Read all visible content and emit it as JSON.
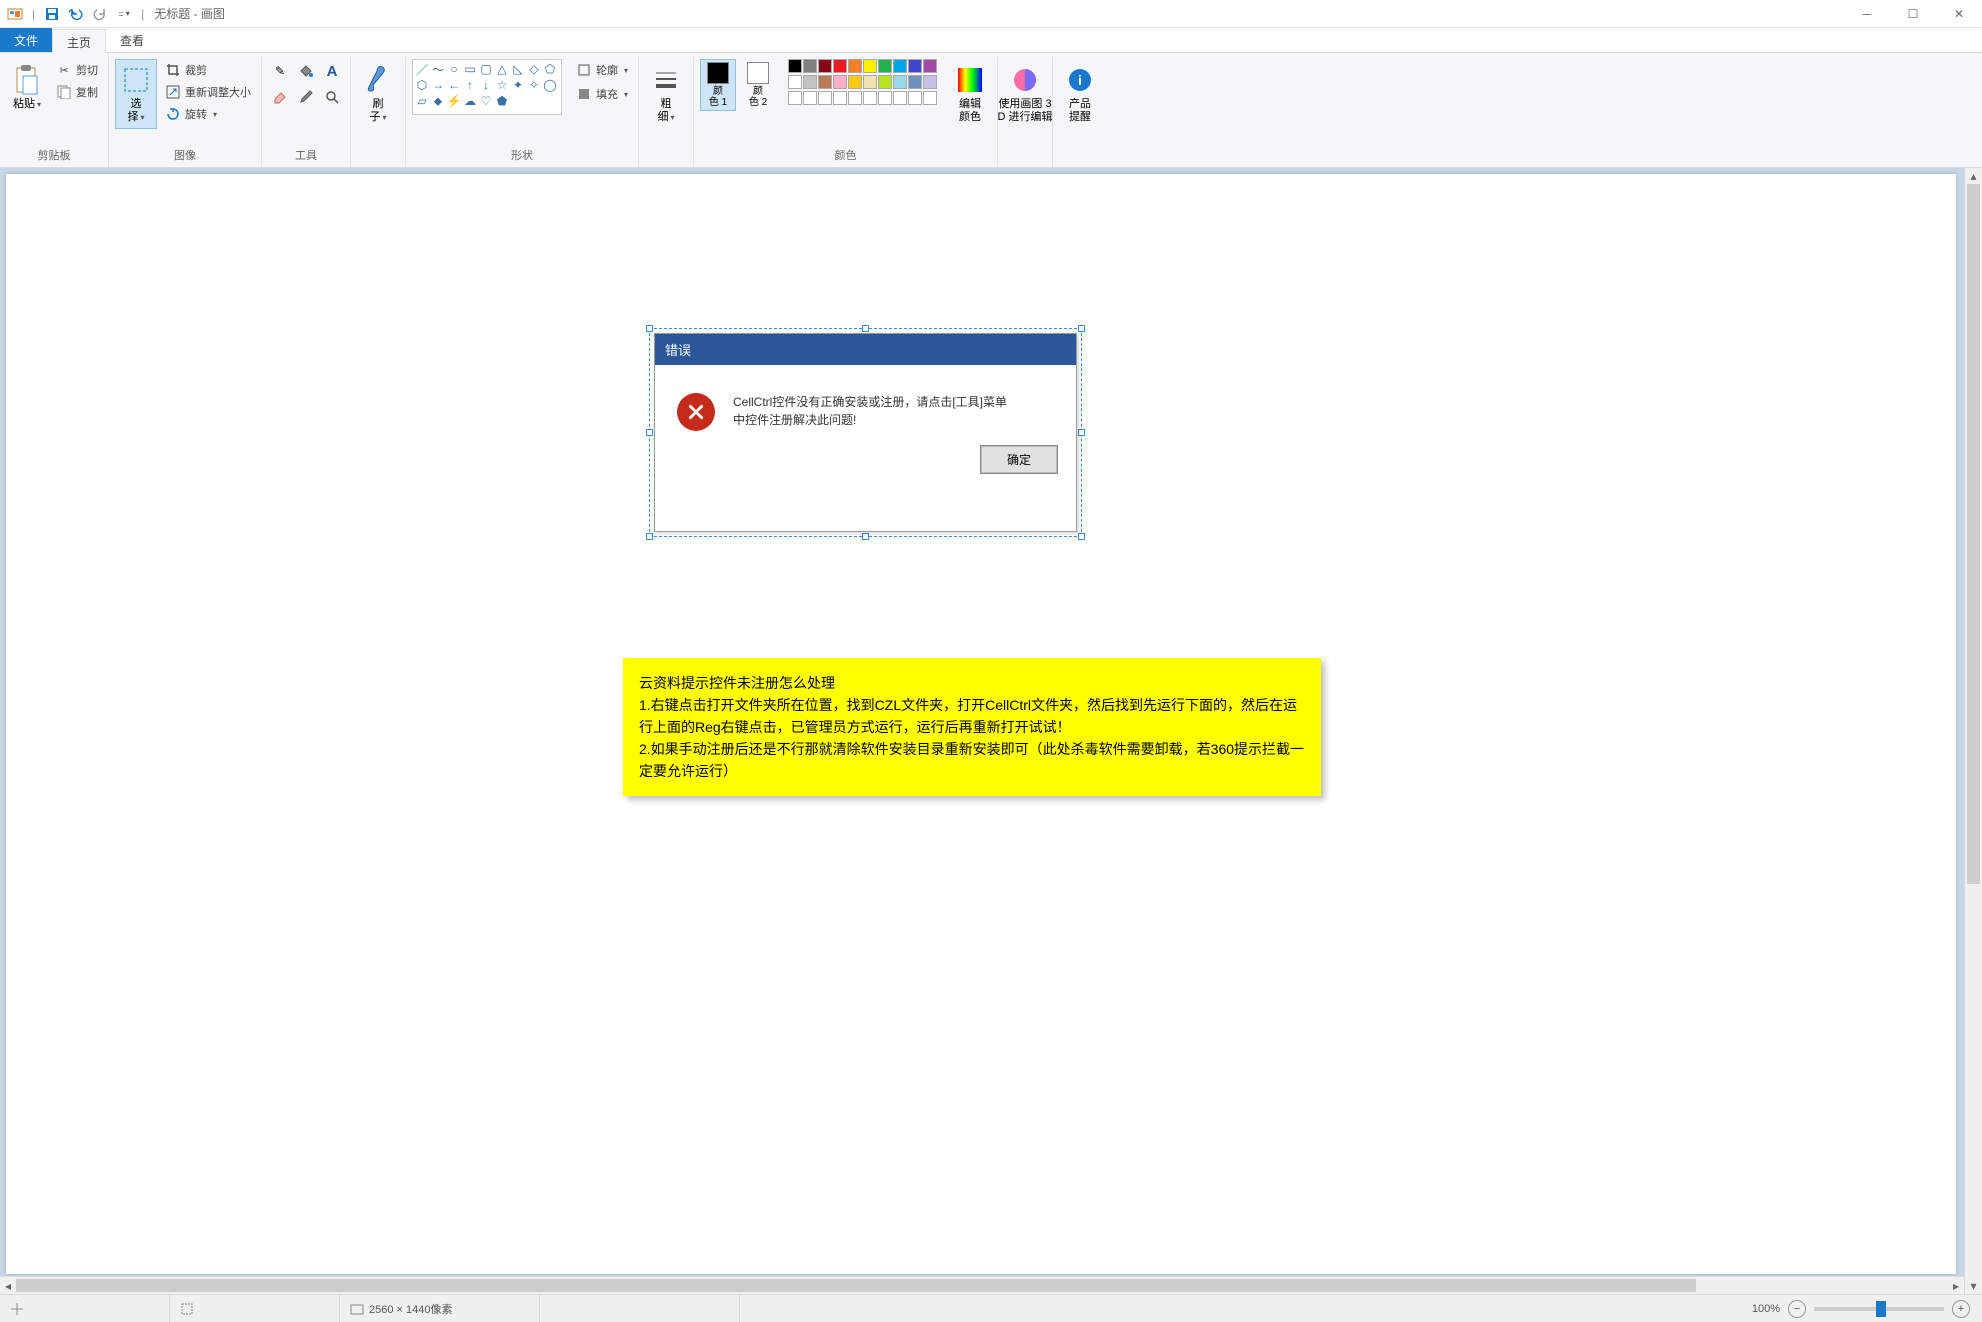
{
  "window": {
    "title": "无标题 - 画图"
  },
  "tabs": {
    "file": "文件",
    "home": "主页",
    "view": "查看"
  },
  "ribbon": {
    "clipboard": {
      "paste": "粘贴",
      "cut": "剪切",
      "copy": "复制",
      "label": "剪贴板"
    },
    "image": {
      "select": "选\n择",
      "crop": "裁剪",
      "resize": "重新调整大小",
      "rotate": "旋转",
      "label": "图像"
    },
    "tools": {
      "label": "工具"
    },
    "brushes": {
      "brush": "刷\n子"
    },
    "shapes": {
      "outline": "轮廓",
      "fill": "填充",
      "label": "形状"
    },
    "size": {
      "label": "粗\n细"
    },
    "colors": {
      "c1": "颜\n色 1",
      "c2": "颜\n色 2",
      "edit": "编辑\n颜色",
      "label": "颜色"
    },
    "paint3d": {
      "label": "使用画图 3\nD 进行编辑"
    },
    "product": {
      "label": "产品\n提醒"
    }
  },
  "palette": {
    "row1": [
      "#000000",
      "#7f7f7f",
      "#880015",
      "#ed1c24",
      "#ff7f27",
      "#fff200",
      "#22b14c",
      "#00a2e8",
      "#3f48cc",
      "#a349a4"
    ],
    "row2": [
      "#ffffff",
      "#c3c3c3",
      "#b97a57",
      "#ffaec9",
      "#ffc90e",
      "#efe4b0",
      "#b5e61d",
      "#99d9ea",
      "#7092be",
      "#c8bfe7"
    ],
    "row3": [
      "#ffffff",
      "#ffffff",
      "#ffffff",
      "#ffffff",
      "#ffffff",
      "#ffffff",
      "#ffffff",
      "#ffffff",
      "#ffffff",
      "#ffffff"
    ]
  },
  "color1": "#000000",
  "color2": "#ffffff",
  "dialog": {
    "title": "错误",
    "message": "CellCtrl控件没有正确安装或注册，请点击[工具]菜单中控件注册解决此问题!",
    "ok": "确定"
  },
  "note": {
    "line1": "云资料提示控件未注册怎么处理",
    "line2": "1.右键点击打开文件夹所在位置，找到CZL文件夹，打开CellCtrl文件夹，然后找到先运行下面的，然后在运行上面的Reg右键点击，已管理员方式运行，运行后再重新打开试试！",
    "line3": "2.如果手动注册后还是不行那就清除软件安装目录重新安装即可（此处杀毒软件需要卸载，若360提示拦截一定要允许运行）"
  },
  "status": {
    "dimensions": "2560 × 1440像素",
    "zoom": "100%"
  }
}
